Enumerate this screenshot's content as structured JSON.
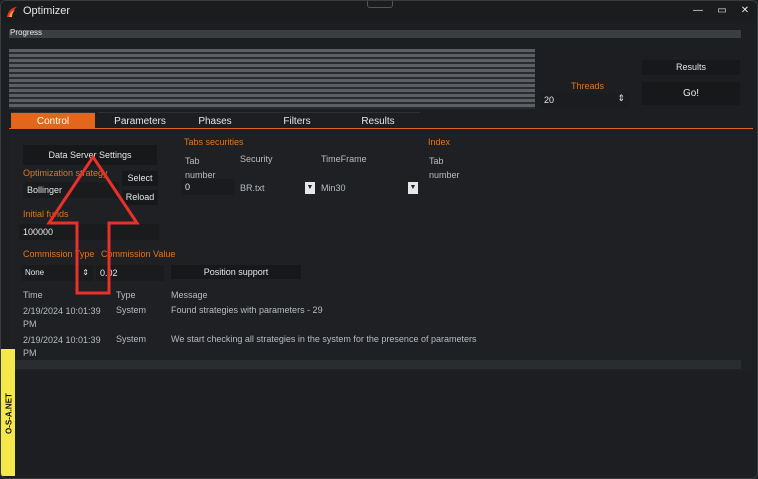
{
  "window": {
    "title": "Optimizer",
    "minimize": "—",
    "maximize": "▭",
    "close": "✕"
  },
  "progress": {
    "label": "Progress"
  },
  "threads": {
    "label": "Threads",
    "value": "20"
  },
  "buttons": {
    "results": "Results",
    "go": "Go!"
  },
  "tabs": [
    {
      "label": "Control"
    },
    {
      "label": "Parameters"
    },
    {
      "label": "Phases"
    },
    {
      "label": "Filters"
    },
    {
      "label": "Results"
    }
  ],
  "control": {
    "data_server_settings": "Data Server Settings",
    "optimization_strategy_label": "Optimization strategy",
    "strategy_value": "Bollinger",
    "select": "Select",
    "reload": "Reload",
    "initial_funds_label": "Initial funds",
    "initial_funds_value": "100000",
    "commission_type_label": "Commission Type",
    "commission_value_label": "Commission Value",
    "commission_type_value": "None",
    "commission_value": "0.02",
    "position_support": "Position support"
  },
  "securities": {
    "header": "Tabs securities",
    "tab_number_label": "Tab\nnumber",
    "security_label": "Security",
    "timeframe_label": "TimeFrame",
    "tab_number_value": "0",
    "security_value": "BR.txt",
    "timeframe_value": "Min30"
  },
  "index": {
    "header": "Index",
    "tab_number_label": "Tab\nnumber"
  },
  "log": {
    "columns": [
      "Time",
      "Type",
      "Message"
    ],
    "rows": [
      {
        "time": "2/19/2024 10:01:39\nPM",
        "type": "System",
        "message": "Found strategies with parameters -  29"
      },
      {
        "time": "2/19/2024 10:01:39\nPM",
        "type": "System",
        "message": "We start checking all strategies in the system for the presence of parameters"
      }
    ]
  },
  "watermark": "O-S-A.NET",
  "colors": {
    "accent": "#e2661b",
    "arrow": "#e8312a",
    "watermark_bg": "#f5e84a"
  }
}
